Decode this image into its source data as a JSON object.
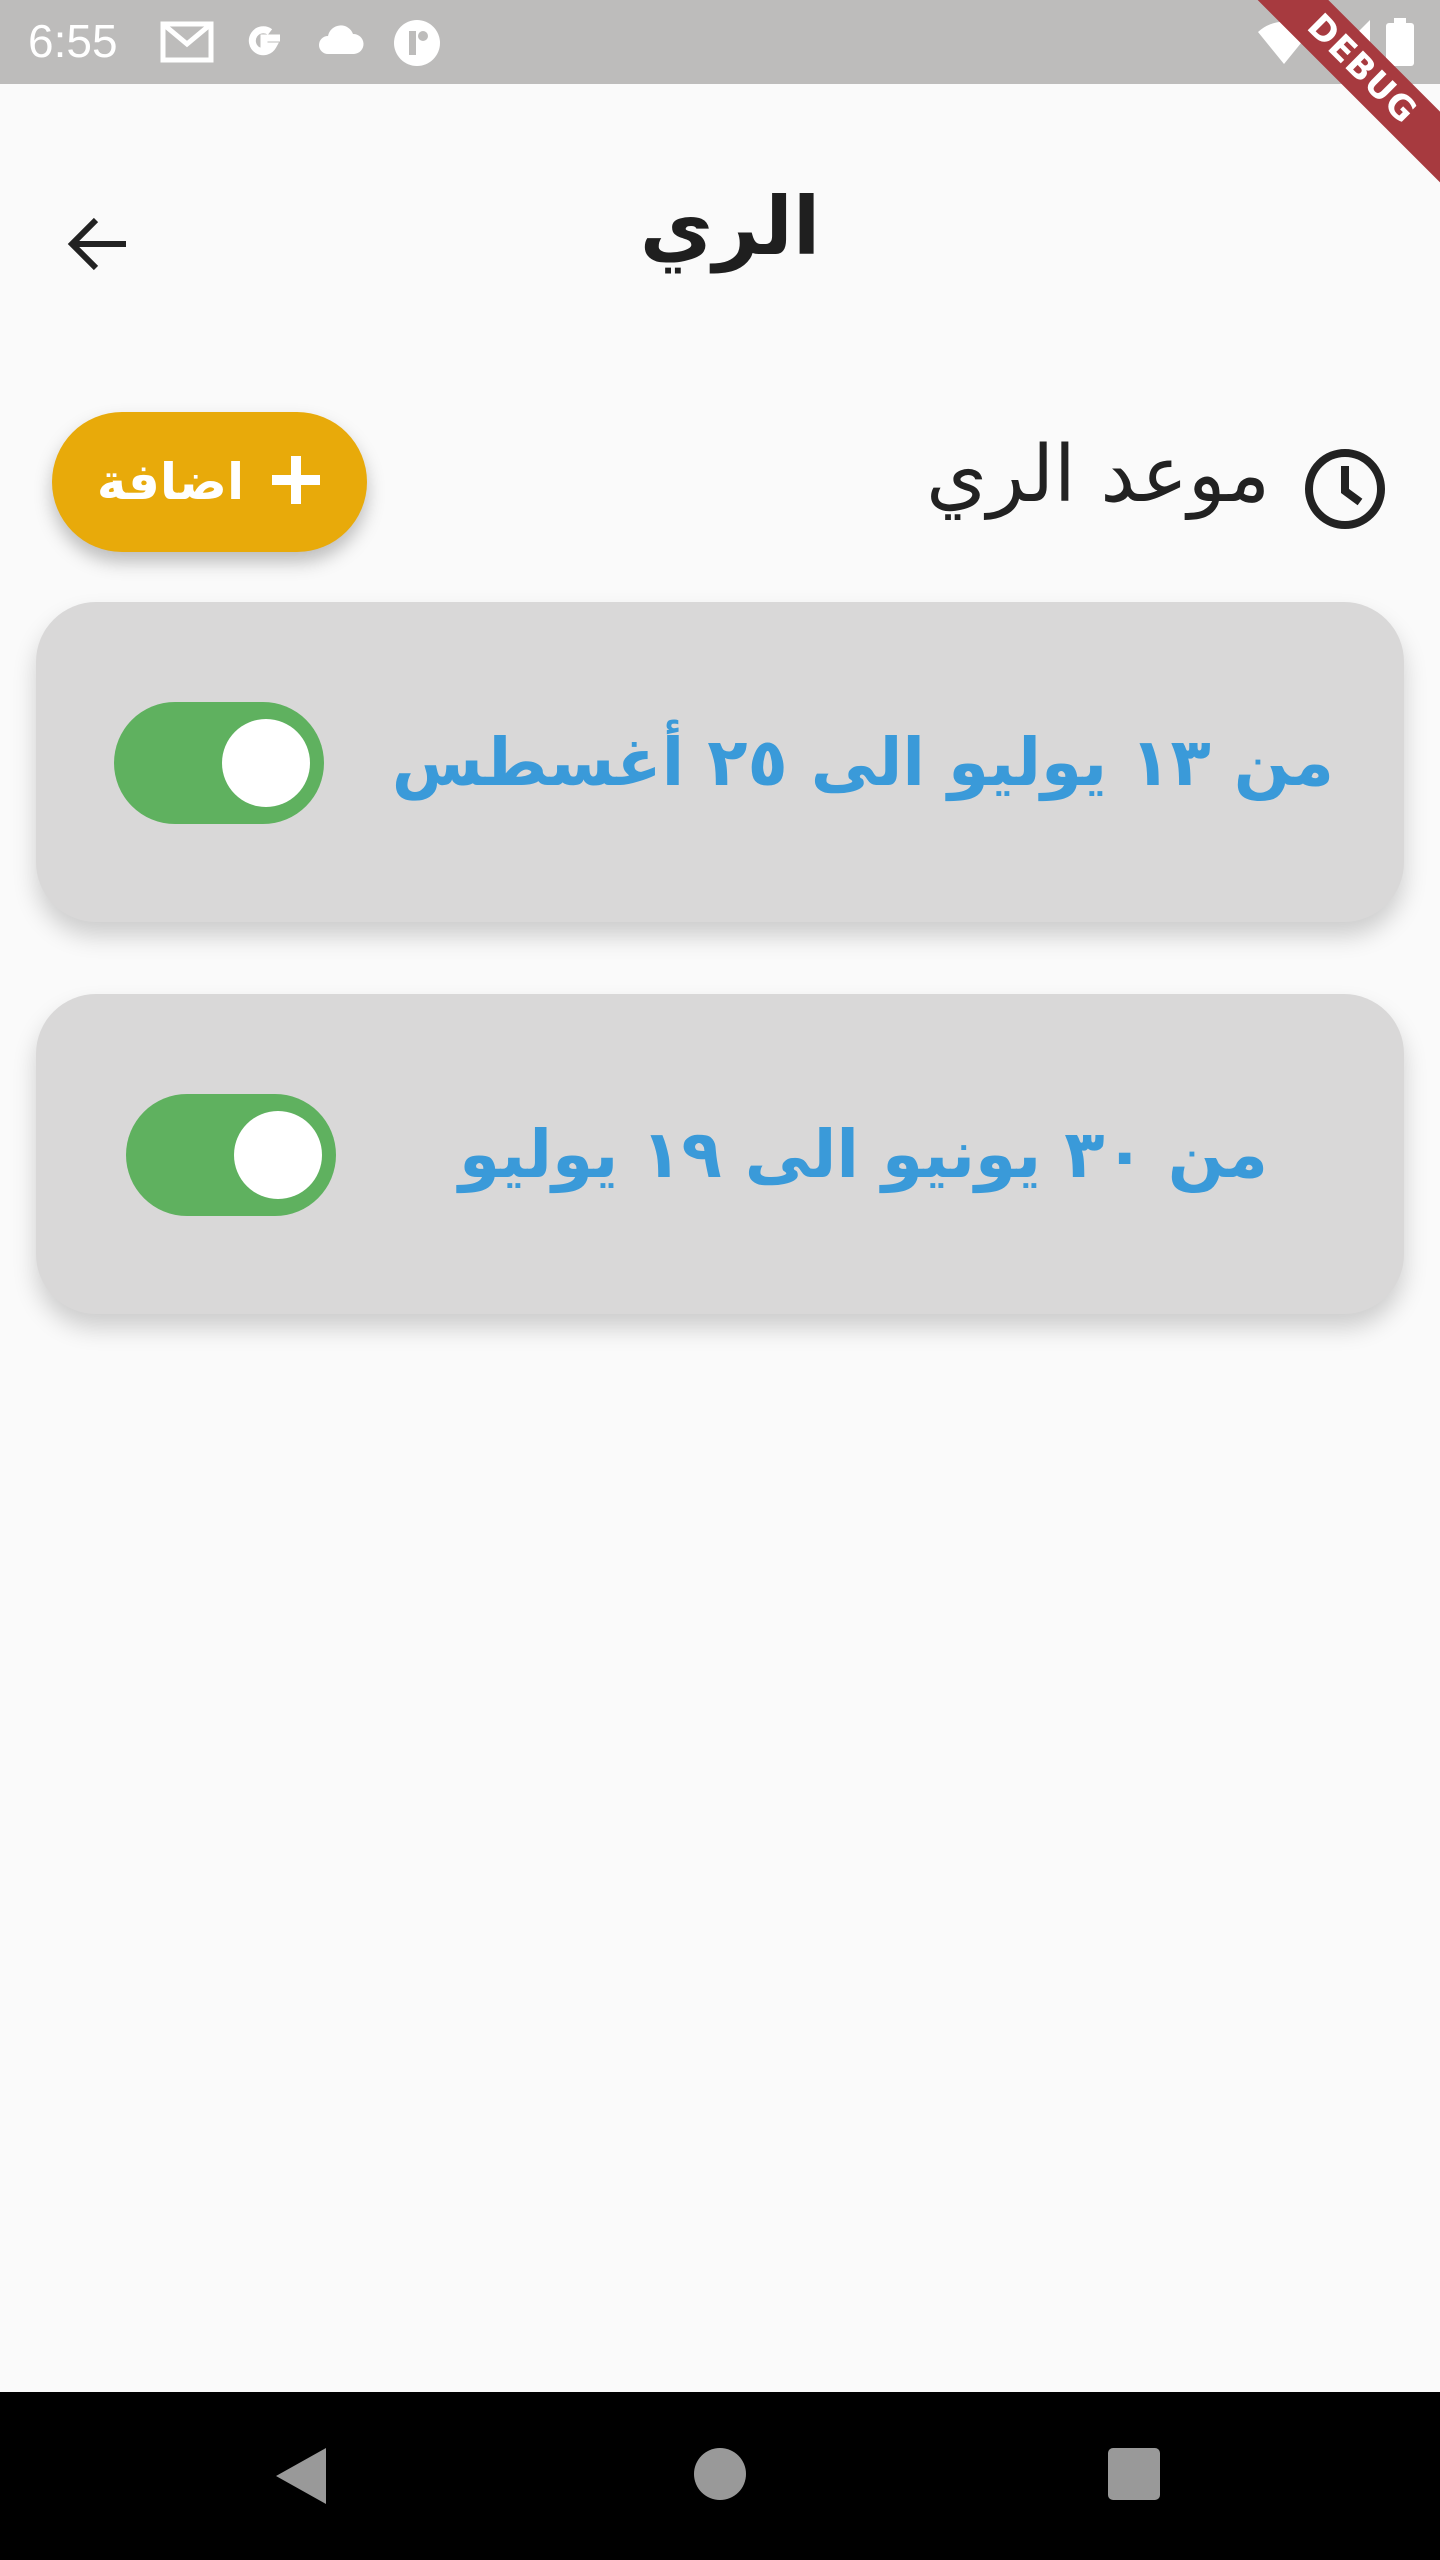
{
  "status_bar": {
    "time": "6:55",
    "left_icons": [
      "gmail-icon",
      "google-icon",
      "cloud-icon",
      "app-icon"
    ],
    "right_icons": [
      "wifi-icon",
      "signal-icon",
      "battery-icon"
    ]
  },
  "debug_banner": "DEBUG",
  "app_bar": {
    "title": "الري",
    "back_icon": "arrow-back-icon"
  },
  "section": {
    "title": "موعد الري",
    "icon": "clock-icon",
    "add_button_label": "اضافة",
    "add_icon": "plus-icon"
  },
  "schedules": [
    {
      "label": "من ١٣ يوليو الى ٢٥ أغسطس",
      "enabled": true
    },
    {
      "label": "من ٣٠ يونيو الى ١٩ يوليو",
      "enabled": true
    }
  ],
  "colors": {
    "accent": "#e8aa0a",
    "toggle_on": "#5fb15f",
    "schedule_text": "#3a9ad9",
    "card_bg": "#d9d8d8"
  },
  "nav_bar": {
    "icons": [
      "nav-back-icon",
      "nav-home-icon",
      "nav-recents-icon"
    ]
  }
}
